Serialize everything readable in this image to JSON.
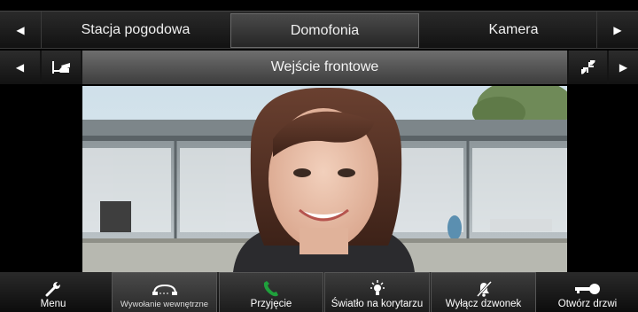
{
  "tabs": {
    "items": [
      {
        "label": "Stacja pogodowa",
        "active": false
      },
      {
        "label": "Domofonia",
        "active": true
      },
      {
        "label": "Kamera",
        "active": false
      }
    ]
  },
  "camera": {
    "title": "Wejście frontowe"
  },
  "toolbar": {
    "menu": "Menu",
    "intercom": "Wywołanie wewnętrzne",
    "accept": "Przyjęcie",
    "hall_light": "Światło na korytarzu",
    "mute_bell": "Wyłącz dzwonek",
    "open_door": "Otwórz drzwi"
  },
  "colors": {
    "accept_icon": "#1fa03c",
    "active_tab": "#3a3a3a",
    "title_bar": "#5a5a5a"
  }
}
